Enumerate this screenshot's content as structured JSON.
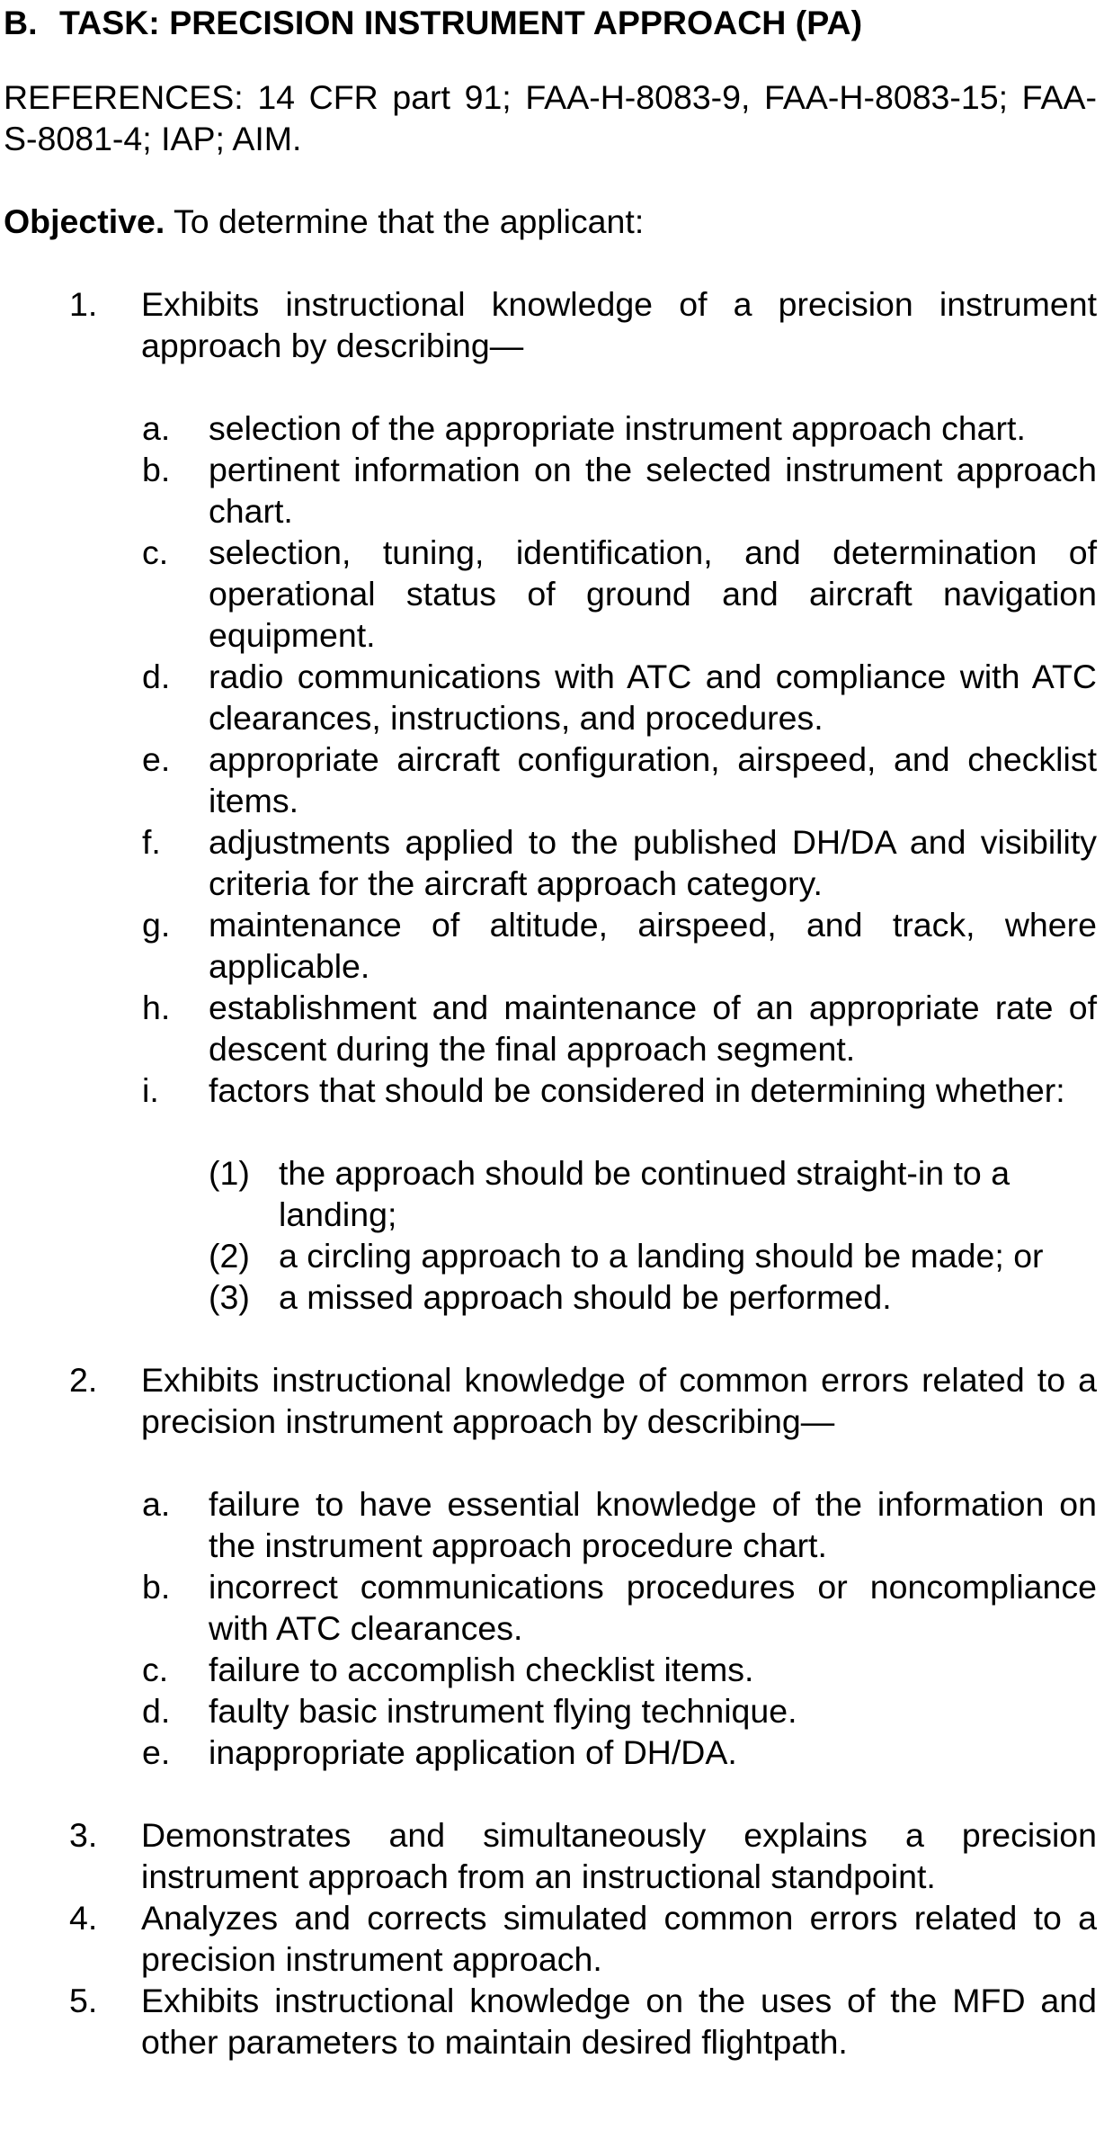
{
  "task": {
    "letter": "B.",
    "title": "TASK: PRECISION INSTRUMENT APPROACH (PA)"
  },
  "references": "REFERENCES: 14 CFR part 91; FAA-H-8083-9, FAA-H-8083-15; FAA-S-8081-4; IAP; AIM.",
  "objective": {
    "label": "Objective.",
    "text": " To determine that the applicant:"
  },
  "items": [
    {
      "num": "1.",
      "text": "Exhibits instructional knowledge of a precision instrument approach by describing—",
      "subs": [
        {
          "letter": "a.",
          "text": "selection of the appropriate instrument approach chart."
        },
        {
          "letter": "b.",
          "text": "pertinent information on the selected instrument approach chart."
        },
        {
          "letter": "c.",
          "text": "selection, tuning, identification, and determination of operational status of ground and aircraft navigation equipment."
        },
        {
          "letter": "d.",
          "text": "radio communications with ATC and compliance with ATC clearances, instructions, and procedures."
        },
        {
          "letter": "e.",
          "text": "appropriate aircraft configuration, airspeed, and checklist items."
        },
        {
          "letter": "f.",
          "text": "adjustments applied to the published DH/DA and visibility criteria for the aircraft approach category."
        },
        {
          "letter": "g.",
          "text": "maintenance of altitude, airspeed, and track, where applicable."
        },
        {
          "letter": "h.",
          "text": "establishment and maintenance of an appropriate rate of descent during the final approach segment."
        },
        {
          "letter": "i.",
          "text": "factors that should be considered in determining whether:"
        }
      ],
      "subsubs": [
        {
          "num": "(1)",
          "text": "the approach should be continued straight-in to a landing;"
        },
        {
          "num": "(2)",
          "text": "a circling approach to a landing should be made; or"
        },
        {
          "num": "(3)",
          "text": "a missed approach should be performed."
        }
      ]
    },
    {
      "num": "2.",
      "text": "Exhibits instructional knowledge of common errors related to a precision instrument approach by describing—",
      "subs": [
        {
          "letter": "a.",
          "text": "failure to have essential knowledge of the information on the instrument approach procedure chart."
        },
        {
          "letter": "b.",
          "text": "incorrect communications procedures or noncompliance with ATC clearances."
        },
        {
          "letter": "c.",
          "text": "failure to accomplish checklist items."
        },
        {
          "letter": "d.",
          "text": "faulty basic instrument flying technique."
        },
        {
          "letter": "e.",
          "text": "inappropriate application of DH/DA."
        }
      ]
    },
    {
      "num": "3.",
      "text": "Demonstrates and simultaneously explains a precision instrument approach from an instructional standpoint."
    },
    {
      "num": "4.",
      "text": "Analyzes and corrects simulated common errors related to a precision instrument approach."
    },
    {
      "num": "5.",
      "text": "Exhibits instructional knowledge on the uses of the MFD and other parameters to maintain desired flightpath."
    }
  ]
}
